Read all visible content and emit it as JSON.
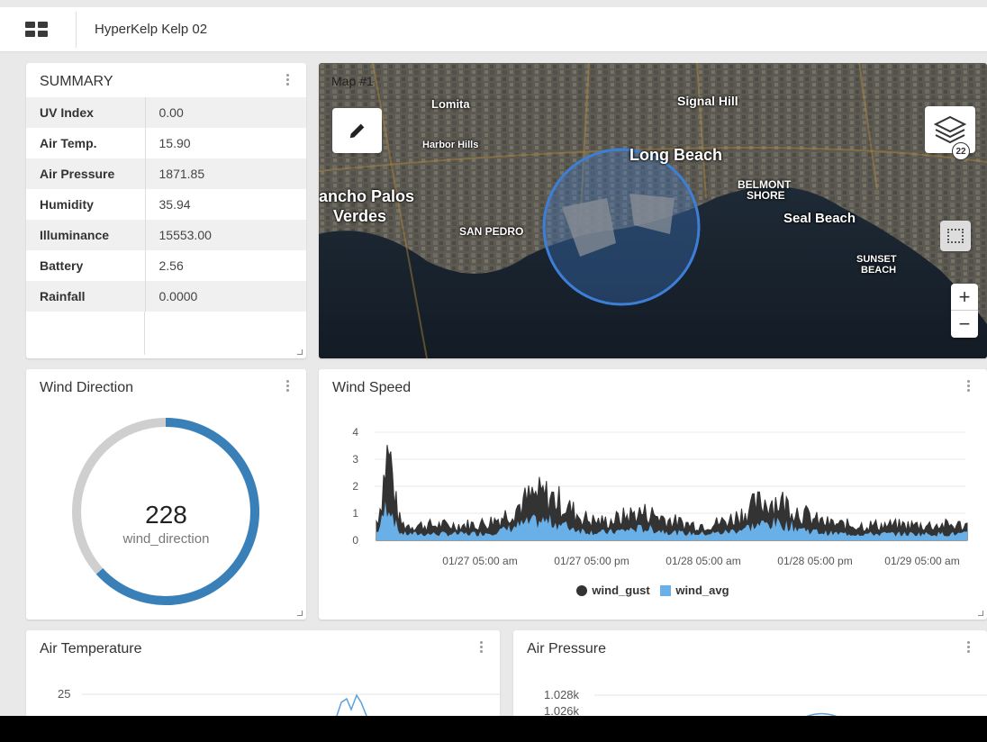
{
  "app": {
    "title": "HyperKelp Kelp 02"
  },
  "summary": {
    "title": "SUMMARY",
    "rows": [
      {
        "label": "UV Index",
        "value": "0.00"
      },
      {
        "label": "Air Temp.",
        "value": "15.90"
      },
      {
        "label": "Air Pressure",
        "value": "1871.85"
      },
      {
        "label": "Humidity",
        "value": "35.94"
      },
      {
        "label": "Illuminance",
        "value": "15553.00"
      },
      {
        "label": "Battery",
        "value": "2.56"
      },
      {
        "label": "Rainfall",
        "value": "0.0000"
      }
    ]
  },
  "map": {
    "title": "Map #1",
    "places": [
      "Long Beach",
      "Signal Hill",
      "Lomita",
      "Harbor Hills",
      "ancho Palos",
      "Verdes",
      "SAN PEDRO",
      "BELMONT",
      "SHORE",
      "Seal Beach",
      "SUNSET",
      "BEACH"
    ],
    "layer_badge": "22",
    "zoom_in": "+",
    "zoom_out": "−"
  },
  "wind_direction": {
    "title": "Wind Direction",
    "value": "228",
    "label": "wind_direction",
    "fraction": 0.633
  },
  "wind_speed": {
    "title": "Wind Speed",
    "chart_data": {
      "type": "area",
      "ylim": [
        0,
        4
      ],
      "yticks": [
        "0",
        "1",
        "2",
        "3",
        "4"
      ],
      "xticks": [
        "01/27 05:00 am",
        "01/27 05:00 pm",
        "01/28 05:00 am",
        "01/28 05:00 pm",
        "01/29 05:00 am"
      ],
      "series": [
        {
          "name": "wind_gust",
          "color": "#333333"
        },
        {
          "name": "wind_avg",
          "color": "#6ab0e8"
        }
      ]
    }
  },
  "air_temperature": {
    "title": "Air Temperature",
    "ytick_top": "25"
  },
  "air_pressure": {
    "title": "Air Pressure",
    "yticks": [
      "1.028k",
      "1.026k"
    ]
  },
  "colors": {
    "accent": "#3a80b8",
    "track": "#cfcfcf"
  }
}
